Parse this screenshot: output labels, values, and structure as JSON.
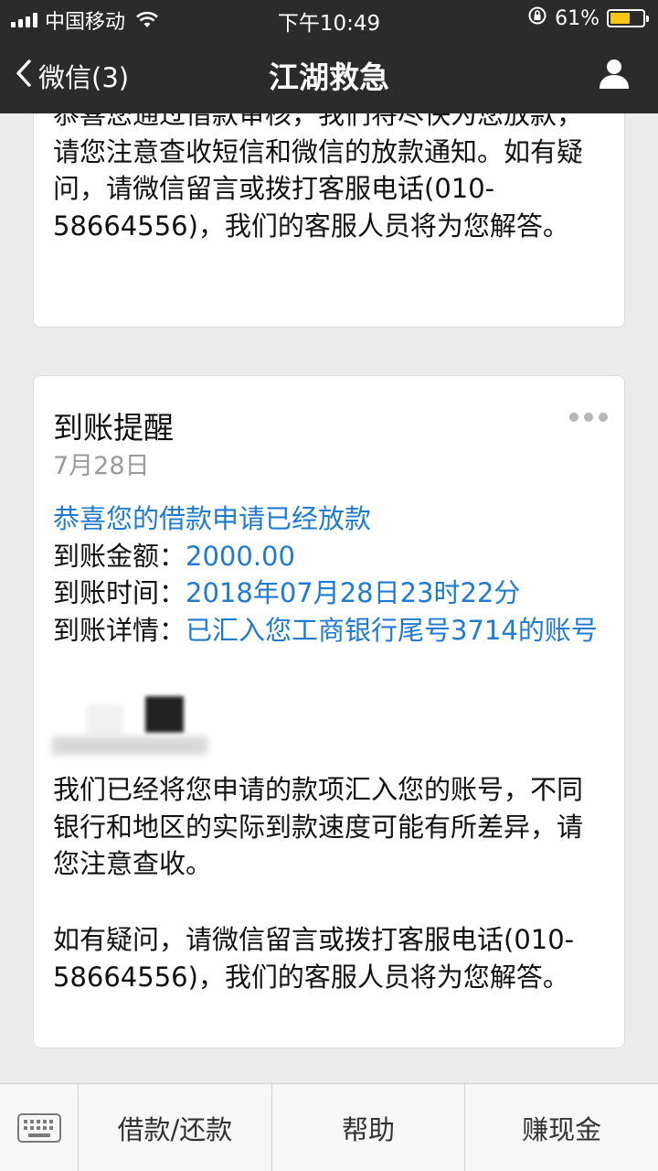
{
  "status": {
    "carrier": "中国移动",
    "time": "下午10:49",
    "battery": "61%",
    "battery_level": 0.61
  },
  "nav": {
    "back_label": "微信(3)",
    "title": "江湖救急"
  },
  "card1": {
    "text": "恭喜您通过借款审核，我们将尽快为您放款，请您注意查收短信和微信的放款通知。如有疑问，请微信留言或拨打客服电话(010-58664556)，我们的客服人员将为您解答。"
  },
  "card2": {
    "heading": "到账提醒",
    "date": "7月28日",
    "congrats": "恭喜您的借款申请已经放款",
    "amount_label": "到账金额：",
    "amount": "2000.00",
    "time_label": "到账时间：",
    "time": "2018年07月28日23时22分",
    "detail_label": "到账详情：",
    "detail": "已汇入您工商银行尾号3714的账号",
    "para2": "我们已经将您申请的款项汇入您的账号，不同银行和地区的实际到款速度可能有所差异，请您注意查收。",
    "para3": "如有疑问，请微信留言或拨打客服电话(010-58664556)，我们的客服人员将为您解答。"
  },
  "menu": {
    "items": [
      "借款/还款",
      "帮助",
      "赚现金"
    ]
  }
}
